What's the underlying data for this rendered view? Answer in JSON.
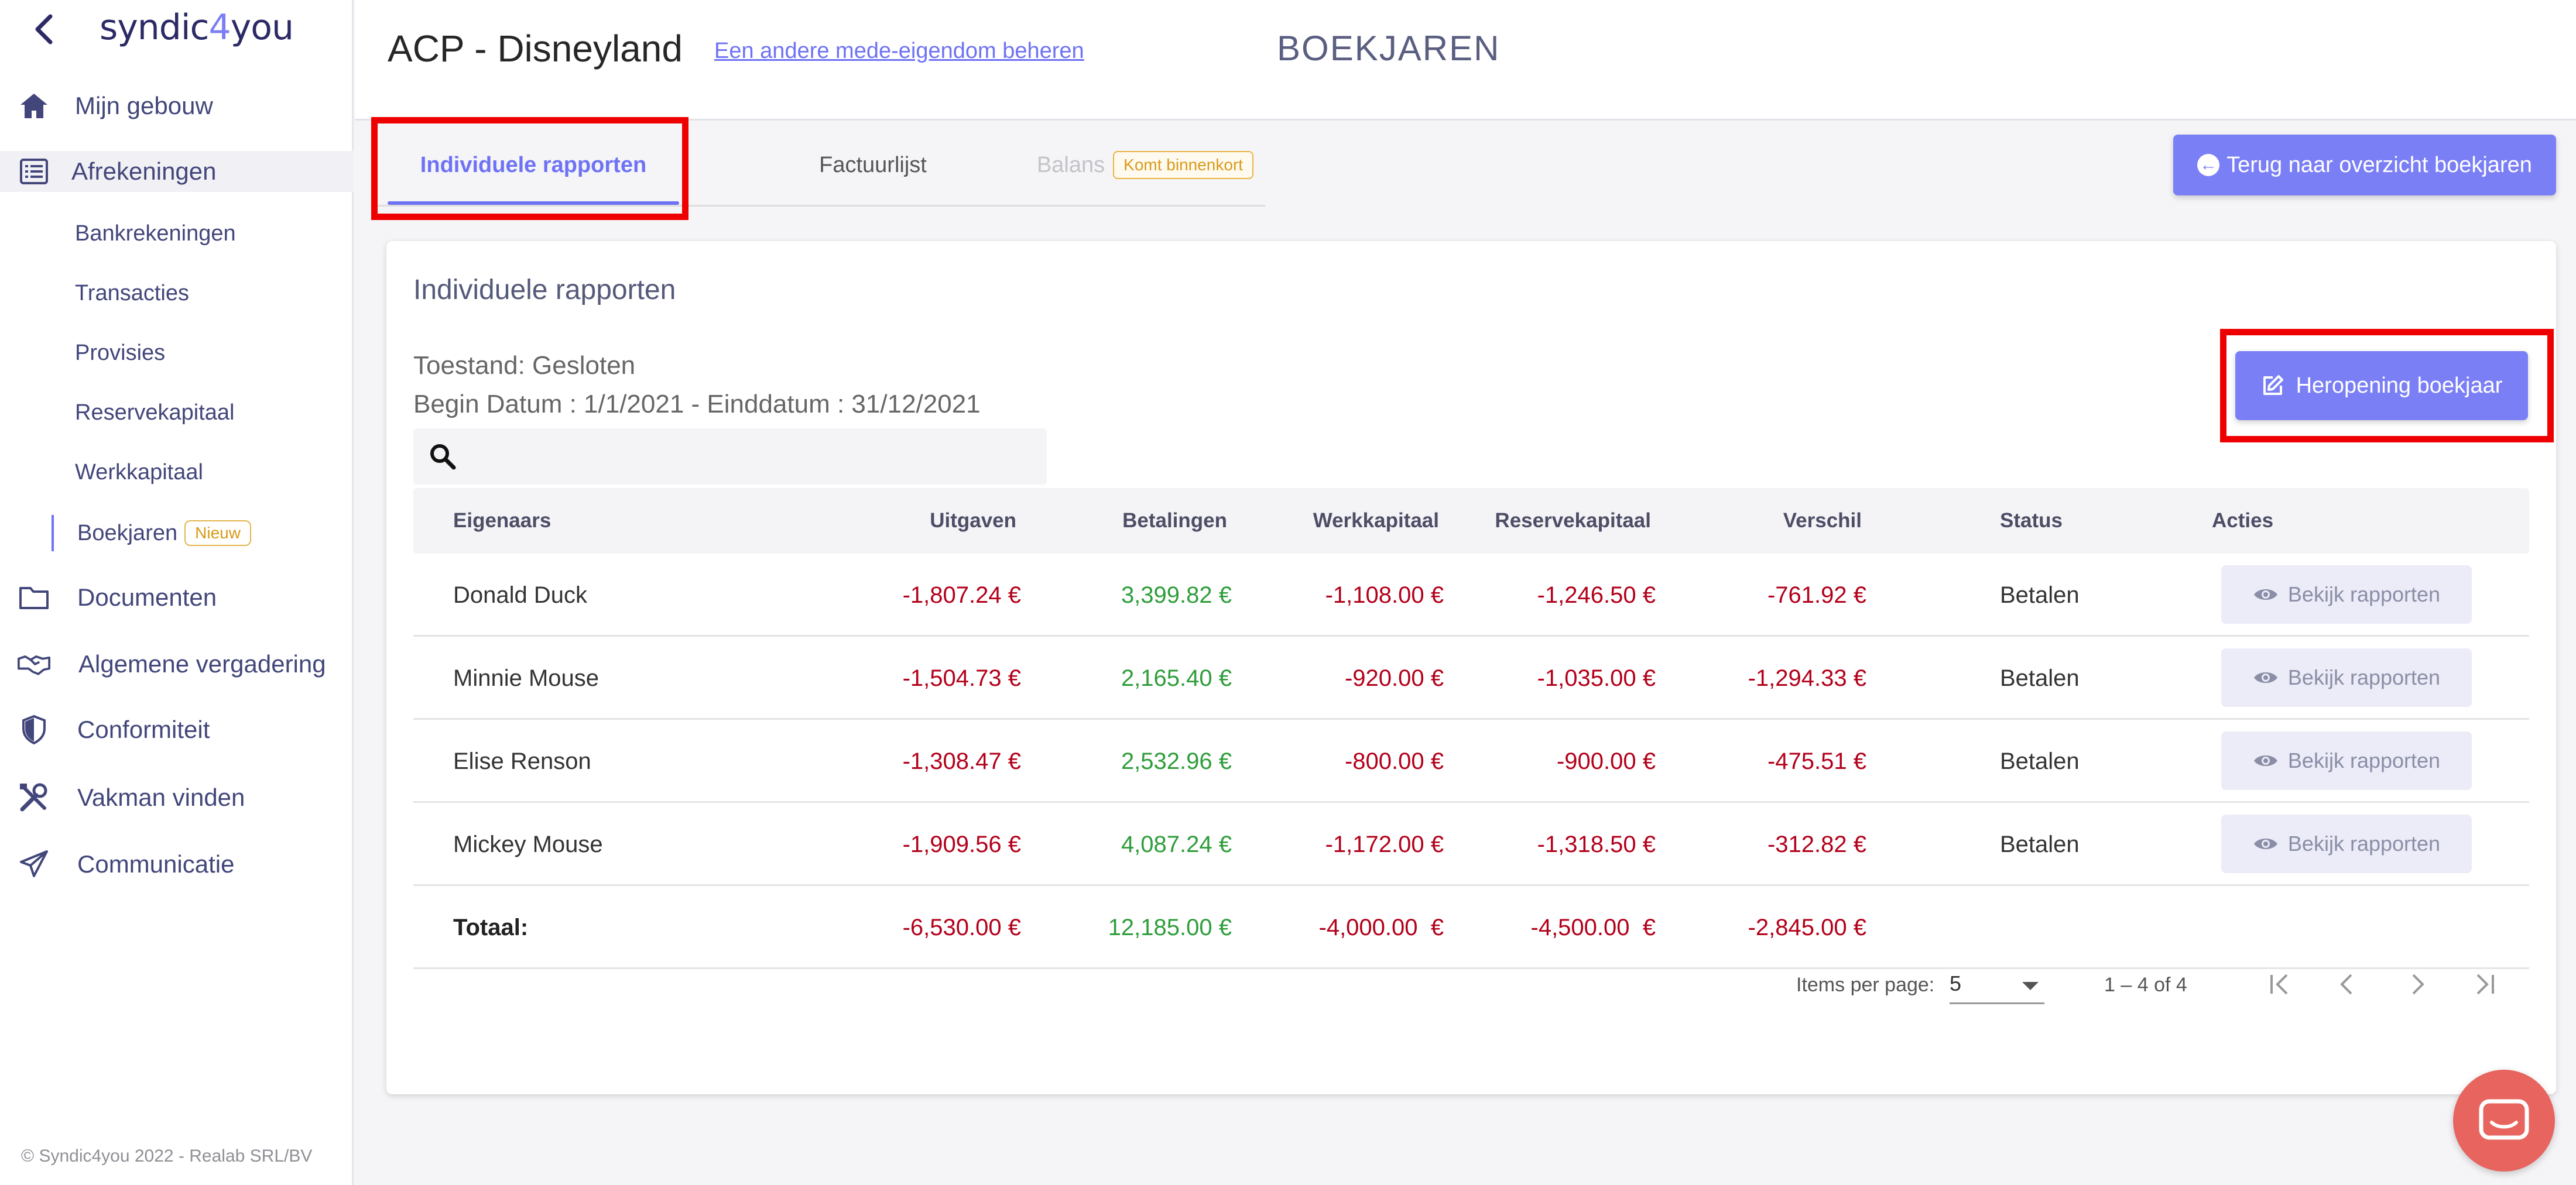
{
  "sidebar": {
    "logo": {
      "part1": "syndic",
      "part2": "4",
      "part3": "you"
    },
    "back_icon": "chevron-left-icon",
    "items": [
      {
        "label": "Mijn gebouw",
        "icon": "home-icon"
      },
      {
        "label": "Afrekeningen",
        "icon": "list-icon"
      },
      {
        "label": "Documenten",
        "icon": "folder-icon"
      },
      {
        "label": "Algemene vergadering",
        "icon": "handshake-icon"
      },
      {
        "label": "Conformiteit",
        "icon": "shield-icon"
      },
      {
        "label": "Vakman vinden",
        "icon": "tools-icon"
      },
      {
        "label": "Communicatie",
        "icon": "paper-plane-icon"
      }
    ],
    "subitems": [
      "Bankrekeningen",
      "Transacties",
      "Provisies",
      "Reservekapitaal",
      "Werkkapitaal",
      "Boekjaren"
    ],
    "new_badge": "Nieuw",
    "copyright": "© Syndic4you 2022 - Realab SRL/BV"
  },
  "header": {
    "title": "ACP - Disneyland",
    "other_link": "Een andere mede-eigendom beheren",
    "section_title": "BOEKJAREN"
  },
  "tabs": [
    {
      "label": "Individuele rapporten",
      "active": true
    },
    {
      "label": "Factuurlijst",
      "active": false
    },
    {
      "label": "Balans",
      "active": false,
      "badge": "Komt binnenkort"
    }
  ],
  "back_overview_label": "Terug naar overzicht boekjaren",
  "card": {
    "title": "Individuele rapporten",
    "state": "Toestand: Gesloten",
    "dates": "Begin Datum : 1/1/2021 - Einddatum : 31/12/2021",
    "reopen_label": "Heropening boekjaar",
    "search_placeholder": ""
  },
  "table": {
    "columns": [
      "Eigenaars",
      "Uitgaven",
      "Betalingen",
      "Werkkapitaal",
      "Reservekapitaal",
      "Verschil",
      "Status",
      "Acties"
    ],
    "rows": [
      {
        "owner": "Donald Duck",
        "uitgaven": "-1,807.24 €",
        "betalingen": "3,399.82 €",
        "werkkapitaal": "-1,108.00 €",
        "reservekapitaal": "-1,246.50 €",
        "verschil": "-761.92 €",
        "status": "Betalen",
        "action": "Bekijk rapporten"
      },
      {
        "owner": "Minnie Mouse",
        "uitgaven": "-1,504.73 €",
        "betalingen": "2,165.40 €",
        "werkkapitaal": "-920.00 €",
        "reservekapitaal": "-1,035.00 €",
        "verschil": "-1,294.33 €",
        "status": "Betalen",
        "action": "Bekijk rapporten"
      },
      {
        "owner": "Elise Renson",
        "uitgaven": "-1,308.47 €",
        "betalingen": "2,532.96 €",
        "werkkapitaal": "-800.00 €",
        "reservekapitaal": "-900.00 €",
        "verschil": "-475.51 €",
        "status": "Betalen",
        "action": "Bekijk rapporten"
      },
      {
        "owner": "Mickey Mouse",
        "uitgaven": "-1,909.56 €",
        "betalingen": "4,087.24 €",
        "werkkapitaal": "-1,172.00 €",
        "reservekapitaal": "-1,318.50 €",
        "verschil": "-312.82 €",
        "status": "Betalen",
        "action": "Bekijk rapporten"
      }
    ],
    "total": {
      "label": "Totaal:",
      "uitgaven": "-6,530.00 €",
      "betalingen": "12,185.00 €",
      "werkkapitaal": "-4,000.00  €",
      "reservekapitaal": "-4,500.00  €",
      "verschil": "-2,845.00 €"
    }
  },
  "paginator": {
    "items_per_page_label": "Items per page:",
    "items_per_page": "5",
    "range": "1 – 4 of 4"
  },
  "colors": {
    "accent": "#7b7ff5",
    "negative": "#b3001a",
    "positive": "#2e9d3a",
    "highlight": "#ef0000",
    "chat": "#e8645e"
  }
}
